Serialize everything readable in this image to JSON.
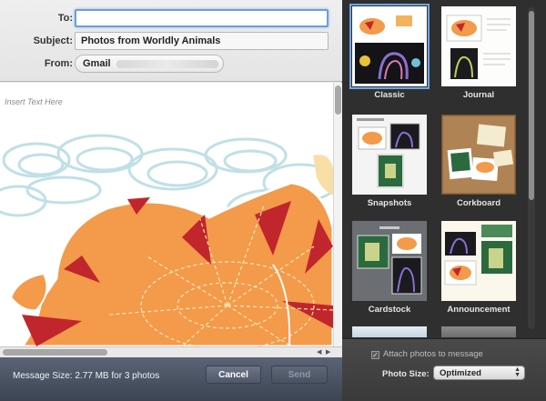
{
  "compose": {
    "to_label": "To:",
    "to_value": "",
    "subject_label": "Subject:",
    "subject_value": "Photos from Worldly Animals",
    "from_label": "From:",
    "from_value": "Gmail",
    "body_placeholder": "Insert Text Here"
  },
  "footer": {
    "message_size": "Message Size: 2.77 MB for 3 photos",
    "cancel_label": "Cancel",
    "send_label": "Send"
  },
  "templates": {
    "items": [
      {
        "label": "Classic",
        "selected": true
      },
      {
        "label": "Journal",
        "selected": false
      },
      {
        "label": "Snapshots",
        "selected": false
      },
      {
        "label": "Corkboard",
        "selected": false
      },
      {
        "label": "Cardstock",
        "selected": false
      },
      {
        "label": "Announcement",
        "selected": false
      }
    ]
  },
  "options": {
    "attach_label": "Attach photos to message",
    "attach_checked": true,
    "photo_size_label": "Photo Size:",
    "photo_size_value": "Optimized"
  },
  "colors": {
    "accent_focus": "#6a9fd8",
    "footer_bg": "#4b5363",
    "template_bg": "#2f2f2f",
    "tiger_orange": "#f39a4b",
    "tiger_stripe": "#c0262c"
  }
}
